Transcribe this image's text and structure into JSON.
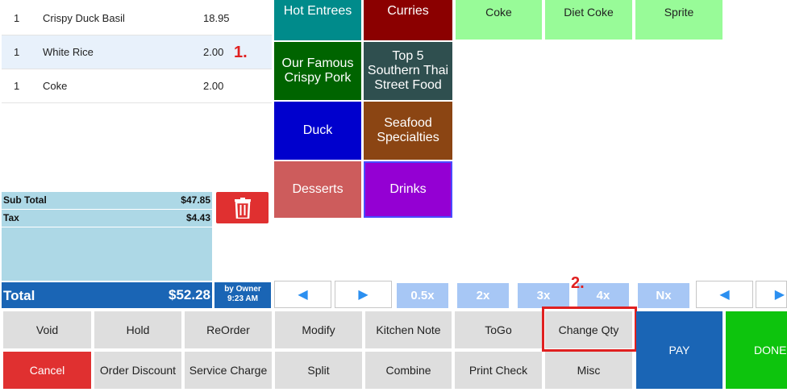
{
  "order": {
    "items": [
      {
        "qty": "1",
        "name": "Crispy Duck Basil",
        "price": "18.95"
      },
      {
        "qty": "1",
        "name": "White Rice",
        "price": "2.00"
      },
      {
        "qty": "1",
        "name": "Coke",
        "price": "2.00"
      }
    ]
  },
  "totals": {
    "subtotal_label": "Sub Total",
    "subtotal": "$47.85",
    "tax_label": "Tax",
    "tax": "$4.43",
    "total_label": "Total",
    "total": "$52.28",
    "by_line": "by Owner",
    "time": "9:23 AM"
  },
  "categories": [
    {
      "label": "Hot Entrees",
      "color": "#008b8b"
    },
    {
      "label": "Curries",
      "color": "#8b0000"
    },
    {
      "label": "Our Famous Crispy Pork",
      "color": "#006400"
    },
    {
      "label": "Top 5 Southern Thai Street Food",
      "color": "#2f4f4f"
    },
    {
      "label": "Duck",
      "color": "#0000cd"
    },
    {
      "label": "Seafood Specialties",
      "color": "#8b4513"
    },
    {
      "label": "Desserts",
      "color": "#cd5c5c"
    },
    {
      "label": "Drinks",
      "color": "#9400d3"
    }
  ],
  "items": [
    {
      "label": "Coke"
    },
    {
      "label": "Diet Coke"
    },
    {
      "label": "Sprite"
    }
  ],
  "multipliers": [
    "0.5x",
    "2x",
    "3x",
    "4x",
    "Nx"
  ],
  "actions": {
    "void": "Void",
    "hold": "Hold",
    "reorder": "ReOrder",
    "modify": "Modify",
    "kitchen_note": "Kitchen Note",
    "togo": "ToGo",
    "change_qty": "Change Qty",
    "pay": "PAY",
    "done": "DONE",
    "cancel": "Cancel",
    "order_discount": "Order Discount",
    "service_charge": "Service Charge",
    "split": "Split",
    "combine": "Combine",
    "print_check": "Print Check",
    "misc": "Misc"
  },
  "annotations": {
    "step1": "1.",
    "step2": "2."
  },
  "colors": {
    "accent_blue": "#1a65b5",
    "cancel_red": "#e03030",
    "pay_blue": "#1a65b5",
    "done_green": "#0dc40d",
    "highlight_red": "#e02020"
  }
}
